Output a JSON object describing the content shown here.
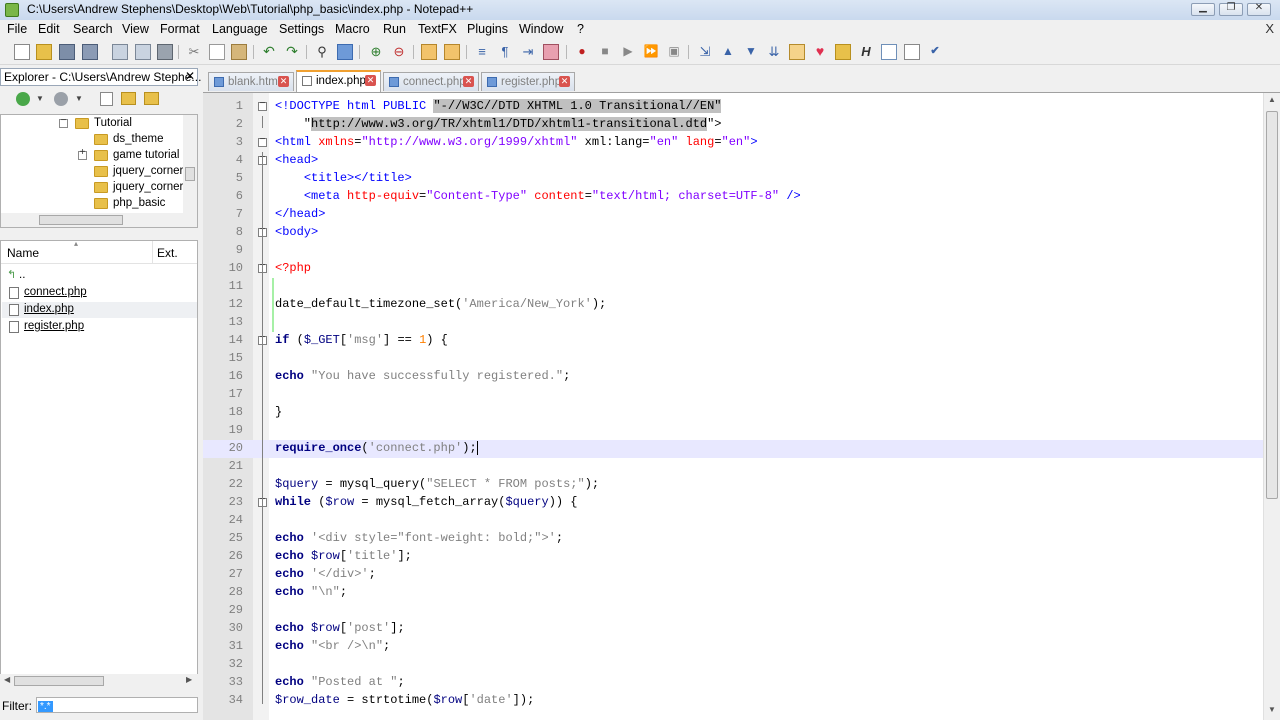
{
  "window": {
    "title": "C:\\Users\\Andrew Stephens\\Desktop\\Web\\Tutorial\\php_basic\\index.php - Notepad++",
    "close_glyph": "X"
  },
  "menu": [
    "File",
    "Edit",
    "Search",
    "View",
    "Format",
    "Language",
    "Settings",
    "Macro",
    "Run",
    "TextFX",
    "Plugins",
    "Window",
    "?"
  ],
  "explorer": {
    "title": "Explorer - C:\\Users\\Andrew Stephe...",
    "close": "✕",
    "tree": [
      {
        "label": "Tutorial",
        "level": 0,
        "expander": "−"
      },
      {
        "label": "ds_theme",
        "level": 1,
        "expander": ""
      },
      {
        "label": "game tutorial",
        "level": 1,
        "expander": "+"
      },
      {
        "label": "jquery_corner",
        "level": 1,
        "expander": ""
      },
      {
        "label": "jquery_corner",
        "level": 1,
        "expander": ""
      },
      {
        "label": "php_basic",
        "level": 1,
        "expander": ""
      }
    ],
    "file_columns": {
      "name": "Name",
      "ext": "Ext."
    },
    "parent_dir": "..",
    "files": [
      "connect.php",
      "index.php",
      "register.php"
    ],
    "filter_label": "Filter:",
    "filter_value": "*.*"
  },
  "tabs": [
    {
      "label": "blank.html",
      "active": false
    },
    {
      "label": "index.php",
      "active": true
    },
    {
      "label": "connect.php",
      "active": false
    },
    {
      "label": "register.php",
      "active": false
    }
  ],
  "editor": {
    "current_line": 20,
    "lines": [
      {
        "n": "1",
        "fold": "−"
      },
      {
        "n": "2"
      },
      {
        "n": "3",
        "fold": "−"
      },
      {
        "n": "4",
        "fold": "−"
      },
      {
        "n": "5"
      },
      {
        "n": "6"
      },
      {
        "n": "7"
      },
      {
        "n": "8",
        "fold": "−"
      },
      {
        "n": "9"
      },
      {
        "n": "10",
        "fold": "−"
      },
      {
        "n": "11"
      },
      {
        "n": "12"
      },
      {
        "n": "13"
      },
      {
        "n": "14",
        "fold": "−"
      },
      {
        "n": "15"
      },
      {
        "n": "16"
      },
      {
        "n": "17"
      },
      {
        "n": "18"
      },
      {
        "n": "19"
      },
      {
        "n": "20"
      },
      {
        "n": "21"
      },
      {
        "n": "22"
      },
      {
        "n": "23",
        "fold": "−"
      },
      {
        "n": "24"
      },
      {
        "n": "25"
      },
      {
        "n": "26"
      },
      {
        "n": "27"
      },
      {
        "n": "28"
      },
      {
        "n": "29"
      },
      {
        "n": "30"
      },
      {
        "n": "31"
      },
      {
        "n": "32"
      },
      {
        "n": "33"
      },
      {
        "n": "34"
      }
    ],
    "tokens": [
      [
        [
          "tag",
          "<!DOCTYPE html PUBLIC "
        ],
        [
          "sel",
          "\"-//W3C//DTD XHTML 1.0 Transitional//EN\""
        ]
      ],
      [
        [
          "",
          "    \""
        ],
        [
          "sel",
          "http://www.w3.org/TR/xhtml1/DTD/xhtml1-transitional.dtd"
        ],
        [
          "",
          "\">"
        ]
      ],
      [
        [
          "tag",
          "<html "
        ],
        [
          "attr",
          "xmlns"
        ],
        [
          "",
          "="
        ],
        [
          "val",
          "\"http://www.w3.org/1999/xhtml\""
        ],
        [
          "",
          " xml:lang="
        ],
        [
          "val",
          "\"en\""
        ],
        [
          "",
          " "
        ],
        [
          "attr",
          "lang"
        ],
        [
          "",
          "="
        ],
        [
          "val",
          "\"en\""
        ],
        [
          "tag",
          ">"
        ]
      ],
      [
        [
          "tag",
          "<head>"
        ]
      ],
      [
        [
          "",
          "    "
        ],
        [
          "tag",
          "<title></title>"
        ]
      ],
      [
        [
          "",
          "    "
        ],
        [
          "tag",
          "<meta "
        ],
        [
          "attr",
          "http-equiv"
        ],
        [
          "",
          "="
        ],
        [
          "val",
          "\"Content-Type\""
        ],
        [
          "",
          " "
        ],
        [
          "attr",
          "content"
        ],
        [
          "",
          "="
        ],
        [
          "val",
          "\"text/html; charset=UTF-8\""
        ],
        [
          "tag",
          " />"
        ]
      ],
      [
        [
          "tag",
          "</head>"
        ]
      ],
      [
        [
          "tag",
          "<body>"
        ]
      ],
      [],
      [
        [
          "php",
          "<?php"
        ]
      ],
      [],
      [
        [
          "",
          "date_default_timezone_set("
        ],
        [
          "str",
          "'America/New_York'"
        ],
        [
          "",
          ");"
        ]
      ],
      [],
      [
        [
          "kw",
          "if"
        ],
        [
          "",
          " ("
        ],
        [
          "var",
          "$_GET"
        ],
        [
          "",
          "["
        ],
        [
          "str",
          "'msg'"
        ],
        [
          "",
          "] == "
        ],
        [
          "num",
          "1"
        ],
        [
          "",
          ") {"
        ]
      ],
      [],
      [
        [
          "kw",
          "echo"
        ],
        [
          "",
          " "
        ],
        [
          "dstr",
          "\"You have successfully registered.\""
        ],
        [
          "",
          ";"
        ]
      ],
      [],
      [
        [
          "",
          "}"
        ]
      ],
      [],
      [
        [
          "kw",
          "require_once"
        ],
        [
          "",
          "("
        ],
        [
          "str",
          "'connect.php'"
        ],
        [
          "",
          ");"
        ],
        [
          "caret",
          ""
        ]
      ],
      [],
      [
        [
          "var",
          "$query"
        ],
        [
          "",
          " = mysql_query("
        ],
        [
          "dstr",
          "\"SELECT * FROM posts;\""
        ],
        [
          "",
          ");"
        ]
      ],
      [
        [
          "kw",
          "while"
        ],
        [
          "",
          " ("
        ],
        [
          "var",
          "$row"
        ],
        [
          "",
          " = mysql_fetch_array("
        ],
        [
          "var",
          "$query"
        ],
        [
          "",
          ")) {"
        ]
      ],
      [],
      [
        [
          "kw",
          "echo"
        ],
        [
          "",
          " "
        ],
        [
          "str",
          "'<div style=\"font-weight: bold;\">'"
        ],
        [
          "",
          ";"
        ]
      ],
      [
        [
          "kw",
          "echo"
        ],
        [
          "",
          " "
        ],
        [
          "var",
          "$row"
        ],
        [
          "",
          "["
        ],
        [
          "str",
          "'title'"
        ],
        [
          "",
          "];"
        ]
      ],
      [
        [
          "kw",
          "echo"
        ],
        [
          "",
          " "
        ],
        [
          "str",
          "'</div>'"
        ],
        [
          "",
          ";"
        ]
      ],
      [
        [
          "kw",
          "echo"
        ],
        [
          "",
          " "
        ],
        [
          "dstr",
          "\"\\n\""
        ],
        [
          "",
          ";"
        ]
      ],
      [],
      [
        [
          "kw",
          "echo"
        ],
        [
          "",
          " "
        ],
        [
          "var",
          "$row"
        ],
        [
          "",
          "["
        ],
        [
          "str",
          "'post'"
        ],
        [
          "",
          "];"
        ]
      ],
      [
        [
          "kw",
          "echo"
        ],
        [
          "",
          " "
        ],
        [
          "dstr",
          "\"<br />\\n\""
        ],
        [
          "",
          ";"
        ]
      ],
      [],
      [
        [
          "kw",
          "echo"
        ],
        [
          "",
          " "
        ],
        [
          "dstr",
          "\"Posted at \""
        ],
        [
          "",
          ";"
        ]
      ],
      [
        [
          "var",
          "$row_date"
        ],
        [
          "",
          " = strtotime("
        ],
        [
          "var",
          "$row"
        ],
        [
          "",
          "["
        ],
        [
          "str",
          "'date'"
        ],
        [
          "",
          "]);"
        ]
      ]
    ]
  }
}
